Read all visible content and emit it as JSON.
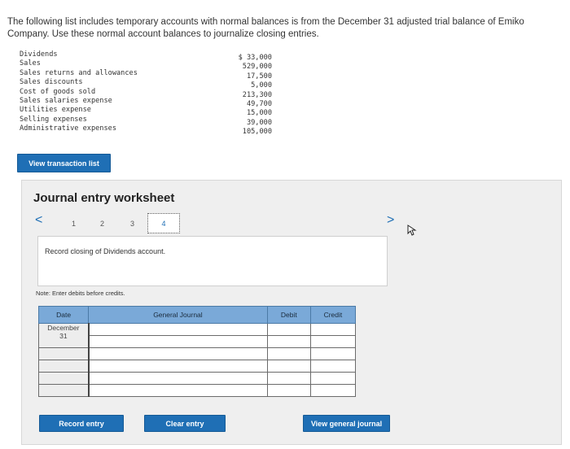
{
  "intro": "The following list includes temporary accounts with normal balances is from the December 31 adjusted trial balance of Emiko Company. Use these normal account balances to journalize closing entries.",
  "accounts": [
    {
      "name": "Dividends",
      "amount": "$ 33,000"
    },
    {
      "name": "Sales",
      "amount": "529,000"
    },
    {
      "name": "Sales returns and allowances",
      "amount": "17,500"
    },
    {
      "name": "Sales discounts",
      "amount": "5,000"
    },
    {
      "name": "Cost of goods sold",
      "amount": "213,300"
    },
    {
      "name": "Sales salaries expense",
      "amount": "49,700"
    },
    {
      "name": "Utilities expense",
      "amount": "15,000"
    },
    {
      "name": "Selling expenses",
      "amount": "39,000"
    },
    {
      "name": "Administrative expenses",
      "amount": "105,000"
    }
  ],
  "view_transaction_label": "View transaction list",
  "worksheet": {
    "title": "Journal entry worksheet",
    "prev_glyph": "<",
    "next_glyph": ">",
    "steps": [
      "1",
      "2",
      "3",
      "4"
    ],
    "active_step": "4",
    "description": "Record closing of Dividends account.",
    "note": "Note: Enter debits before credits.",
    "columns": {
      "date": "Date",
      "journal": "General Journal",
      "debit": "Debit",
      "credit": "Credit"
    },
    "date_month": "December",
    "date_day": "31",
    "record_label": "Record entry",
    "clear_label": "Clear entry",
    "view_journal_label": "View general journal"
  }
}
